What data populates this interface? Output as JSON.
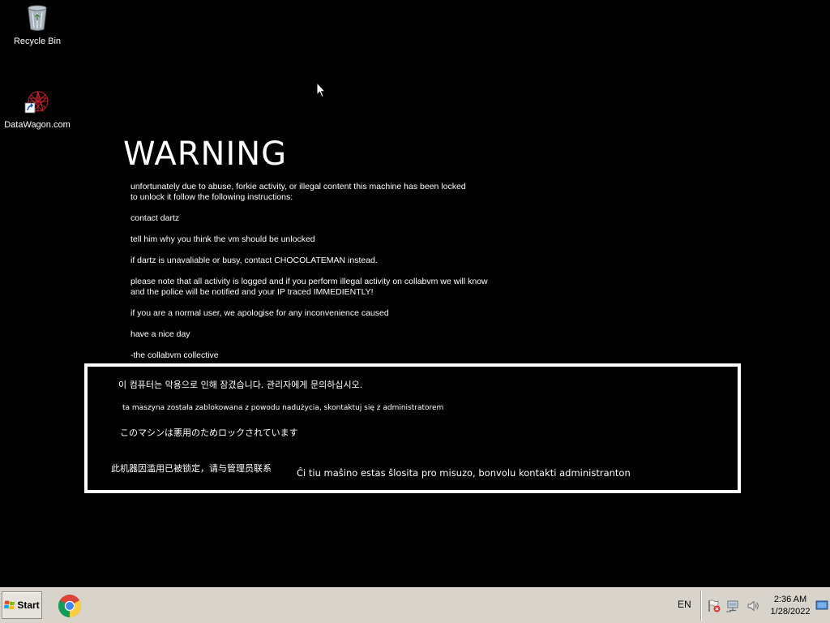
{
  "desktop": {
    "icons": [
      {
        "label": "Recycle Bin",
        "icon": "recycle-bin-icon"
      },
      {
        "label": "DataWagon.com",
        "icon": "datawagon-shortcut-icon"
      }
    ]
  },
  "warning": {
    "title": "WARNING",
    "paragraphs": [
      "unfortunately due to abuse, forkie activity, or illegal content this machine has been locked\nto unlock it follow the following instructions:",
      "contact dartz",
      "tell him why you think the vm should be unlocked",
      "if dartz is unavaliable or busy, contact CHOCOLATEMAN instead.",
      "please note that all activity is logged and if you perform illegal activity on collabvm we will know\nand the police will be notified and your IP traced IMMEDIENTLY!",
      "if you are a normal user, we apologise for any inconvenience caused",
      "have a nice day",
      "-the collabvm collective"
    ]
  },
  "notice": {
    "korean": "이 컴퓨터는 악용으로 인해 잠겼습니다. 관리자에게 문의하십시오.",
    "polish": "ta maszyna została zablokowana z powodu nadużycia, skontaktuj się z administratorem",
    "japanese": "このマシンは悪用のためロックされています",
    "chinese": "此机器因滥用已被锁定，请与管理员联系",
    "esperanto": "Ĉi tiu maŝino estas ŝlosita pro misuzo, bonvolu kontakti administranton"
  },
  "taskbar": {
    "start_label": "Start",
    "pinned": [
      {
        "name": "chrome",
        "icon": "chrome-icon"
      }
    ],
    "language": "EN",
    "tray_icons": [
      "action-center-flag-icon",
      "network-icon",
      "volume-icon"
    ],
    "clock_time": "2:36 AM",
    "clock_date": "1/28/2022"
  },
  "colors": {
    "desktop_background": "#000000",
    "text": "#ffffff",
    "taskbar": "#d8d4cc"
  }
}
